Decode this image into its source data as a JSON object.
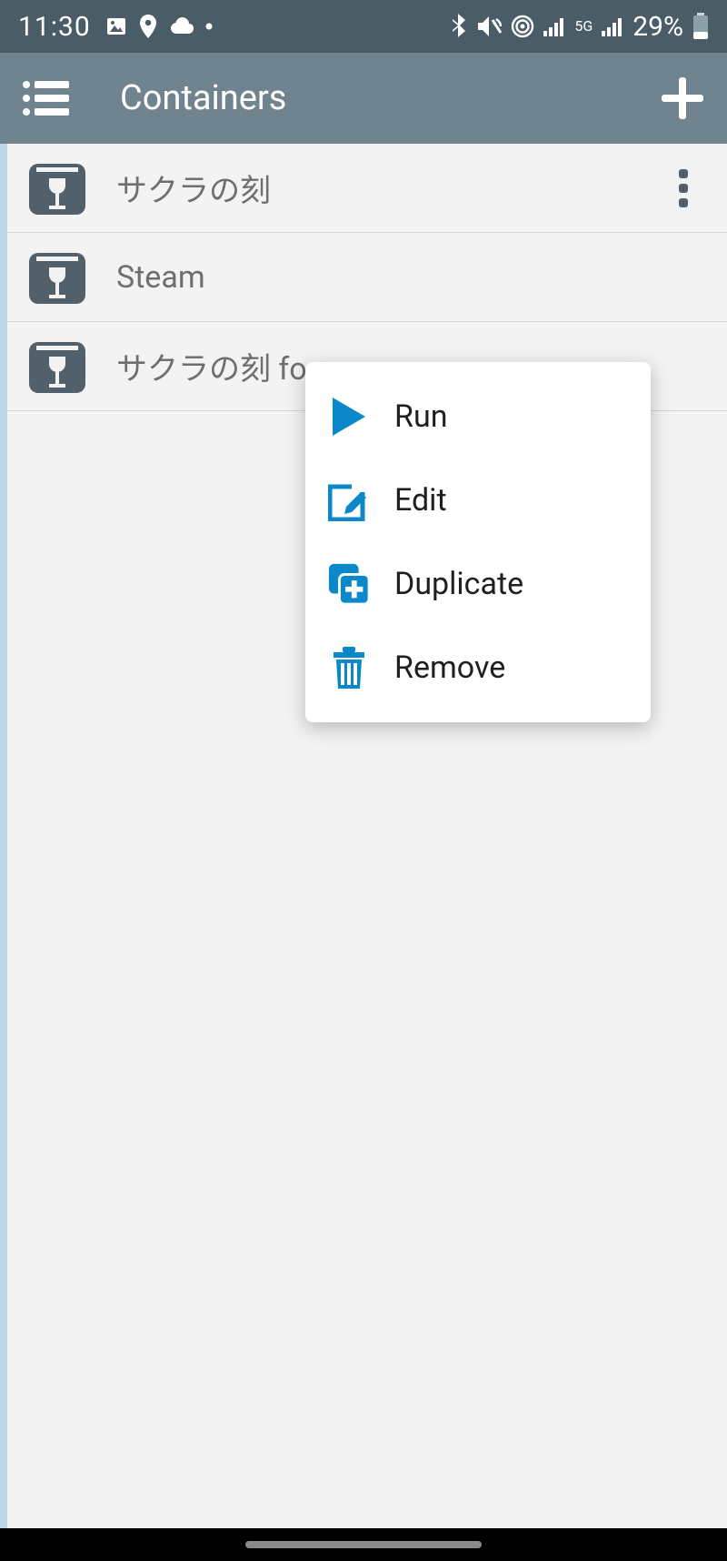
{
  "status": {
    "time": "11:30",
    "network_label": "5G",
    "battery_text": "29%"
  },
  "appbar": {
    "title": "Containers"
  },
  "containers": [
    {
      "name": "サクラの刻"
    },
    {
      "name": "Steam"
    },
    {
      "name": "サクラの刻 for n"
    }
  ],
  "menu": {
    "run": "Run",
    "edit": "Edit",
    "duplicate": "Duplicate",
    "remove": "Remove"
  },
  "colors": {
    "accent": "#0b88c9",
    "appbar": "#6f848f",
    "statusbar": "#4a5d66",
    "icon_dark": "#52606b"
  }
}
